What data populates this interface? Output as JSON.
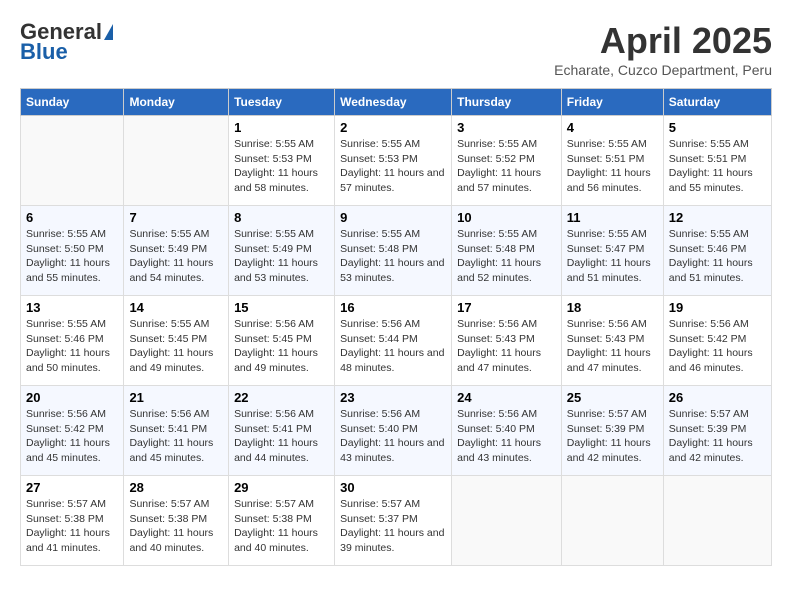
{
  "header": {
    "logo_general": "General",
    "logo_blue": "Blue",
    "title": "April 2025",
    "subtitle": "Echarate, Cuzco Department, Peru"
  },
  "columns": [
    "Sunday",
    "Monday",
    "Tuesday",
    "Wednesday",
    "Thursday",
    "Friday",
    "Saturday"
  ],
  "weeks": [
    [
      {
        "day": "",
        "sunrise": "",
        "sunset": "",
        "daylight": ""
      },
      {
        "day": "",
        "sunrise": "",
        "sunset": "",
        "daylight": ""
      },
      {
        "day": "1",
        "sunrise": "Sunrise: 5:55 AM",
        "sunset": "Sunset: 5:53 PM",
        "daylight": "Daylight: 11 hours and 58 minutes."
      },
      {
        "day": "2",
        "sunrise": "Sunrise: 5:55 AM",
        "sunset": "Sunset: 5:53 PM",
        "daylight": "Daylight: 11 hours and 57 minutes."
      },
      {
        "day": "3",
        "sunrise": "Sunrise: 5:55 AM",
        "sunset": "Sunset: 5:52 PM",
        "daylight": "Daylight: 11 hours and 57 minutes."
      },
      {
        "day": "4",
        "sunrise": "Sunrise: 5:55 AM",
        "sunset": "Sunset: 5:51 PM",
        "daylight": "Daylight: 11 hours and 56 minutes."
      },
      {
        "day": "5",
        "sunrise": "Sunrise: 5:55 AM",
        "sunset": "Sunset: 5:51 PM",
        "daylight": "Daylight: 11 hours and 55 minutes."
      }
    ],
    [
      {
        "day": "6",
        "sunrise": "Sunrise: 5:55 AM",
        "sunset": "Sunset: 5:50 PM",
        "daylight": "Daylight: 11 hours and 55 minutes."
      },
      {
        "day": "7",
        "sunrise": "Sunrise: 5:55 AM",
        "sunset": "Sunset: 5:49 PM",
        "daylight": "Daylight: 11 hours and 54 minutes."
      },
      {
        "day": "8",
        "sunrise": "Sunrise: 5:55 AM",
        "sunset": "Sunset: 5:49 PM",
        "daylight": "Daylight: 11 hours and 53 minutes."
      },
      {
        "day": "9",
        "sunrise": "Sunrise: 5:55 AM",
        "sunset": "Sunset: 5:48 PM",
        "daylight": "Daylight: 11 hours and 53 minutes."
      },
      {
        "day": "10",
        "sunrise": "Sunrise: 5:55 AM",
        "sunset": "Sunset: 5:48 PM",
        "daylight": "Daylight: 11 hours and 52 minutes."
      },
      {
        "day": "11",
        "sunrise": "Sunrise: 5:55 AM",
        "sunset": "Sunset: 5:47 PM",
        "daylight": "Daylight: 11 hours and 51 minutes."
      },
      {
        "day": "12",
        "sunrise": "Sunrise: 5:55 AM",
        "sunset": "Sunset: 5:46 PM",
        "daylight": "Daylight: 11 hours and 51 minutes."
      }
    ],
    [
      {
        "day": "13",
        "sunrise": "Sunrise: 5:55 AM",
        "sunset": "Sunset: 5:46 PM",
        "daylight": "Daylight: 11 hours and 50 minutes."
      },
      {
        "day": "14",
        "sunrise": "Sunrise: 5:55 AM",
        "sunset": "Sunset: 5:45 PM",
        "daylight": "Daylight: 11 hours and 49 minutes."
      },
      {
        "day": "15",
        "sunrise": "Sunrise: 5:56 AM",
        "sunset": "Sunset: 5:45 PM",
        "daylight": "Daylight: 11 hours and 49 minutes."
      },
      {
        "day": "16",
        "sunrise": "Sunrise: 5:56 AM",
        "sunset": "Sunset: 5:44 PM",
        "daylight": "Daylight: 11 hours and 48 minutes."
      },
      {
        "day": "17",
        "sunrise": "Sunrise: 5:56 AM",
        "sunset": "Sunset: 5:43 PM",
        "daylight": "Daylight: 11 hours and 47 minutes."
      },
      {
        "day": "18",
        "sunrise": "Sunrise: 5:56 AM",
        "sunset": "Sunset: 5:43 PM",
        "daylight": "Daylight: 11 hours and 47 minutes."
      },
      {
        "day": "19",
        "sunrise": "Sunrise: 5:56 AM",
        "sunset": "Sunset: 5:42 PM",
        "daylight": "Daylight: 11 hours and 46 minutes."
      }
    ],
    [
      {
        "day": "20",
        "sunrise": "Sunrise: 5:56 AM",
        "sunset": "Sunset: 5:42 PM",
        "daylight": "Daylight: 11 hours and 45 minutes."
      },
      {
        "day": "21",
        "sunrise": "Sunrise: 5:56 AM",
        "sunset": "Sunset: 5:41 PM",
        "daylight": "Daylight: 11 hours and 45 minutes."
      },
      {
        "day": "22",
        "sunrise": "Sunrise: 5:56 AM",
        "sunset": "Sunset: 5:41 PM",
        "daylight": "Daylight: 11 hours and 44 minutes."
      },
      {
        "day": "23",
        "sunrise": "Sunrise: 5:56 AM",
        "sunset": "Sunset: 5:40 PM",
        "daylight": "Daylight: 11 hours and 43 minutes."
      },
      {
        "day": "24",
        "sunrise": "Sunrise: 5:56 AM",
        "sunset": "Sunset: 5:40 PM",
        "daylight": "Daylight: 11 hours and 43 minutes."
      },
      {
        "day": "25",
        "sunrise": "Sunrise: 5:57 AM",
        "sunset": "Sunset: 5:39 PM",
        "daylight": "Daylight: 11 hours and 42 minutes."
      },
      {
        "day": "26",
        "sunrise": "Sunrise: 5:57 AM",
        "sunset": "Sunset: 5:39 PM",
        "daylight": "Daylight: 11 hours and 42 minutes."
      }
    ],
    [
      {
        "day": "27",
        "sunrise": "Sunrise: 5:57 AM",
        "sunset": "Sunset: 5:38 PM",
        "daylight": "Daylight: 11 hours and 41 minutes."
      },
      {
        "day": "28",
        "sunrise": "Sunrise: 5:57 AM",
        "sunset": "Sunset: 5:38 PM",
        "daylight": "Daylight: 11 hours and 40 minutes."
      },
      {
        "day": "29",
        "sunrise": "Sunrise: 5:57 AM",
        "sunset": "Sunset: 5:38 PM",
        "daylight": "Daylight: 11 hours and 40 minutes."
      },
      {
        "day": "30",
        "sunrise": "Sunrise: 5:57 AM",
        "sunset": "Sunset: 5:37 PM",
        "daylight": "Daylight: 11 hours and 39 minutes."
      },
      {
        "day": "",
        "sunrise": "",
        "sunset": "",
        "daylight": ""
      },
      {
        "day": "",
        "sunrise": "",
        "sunset": "",
        "daylight": ""
      },
      {
        "day": "",
        "sunrise": "",
        "sunset": "",
        "daylight": ""
      }
    ]
  ]
}
